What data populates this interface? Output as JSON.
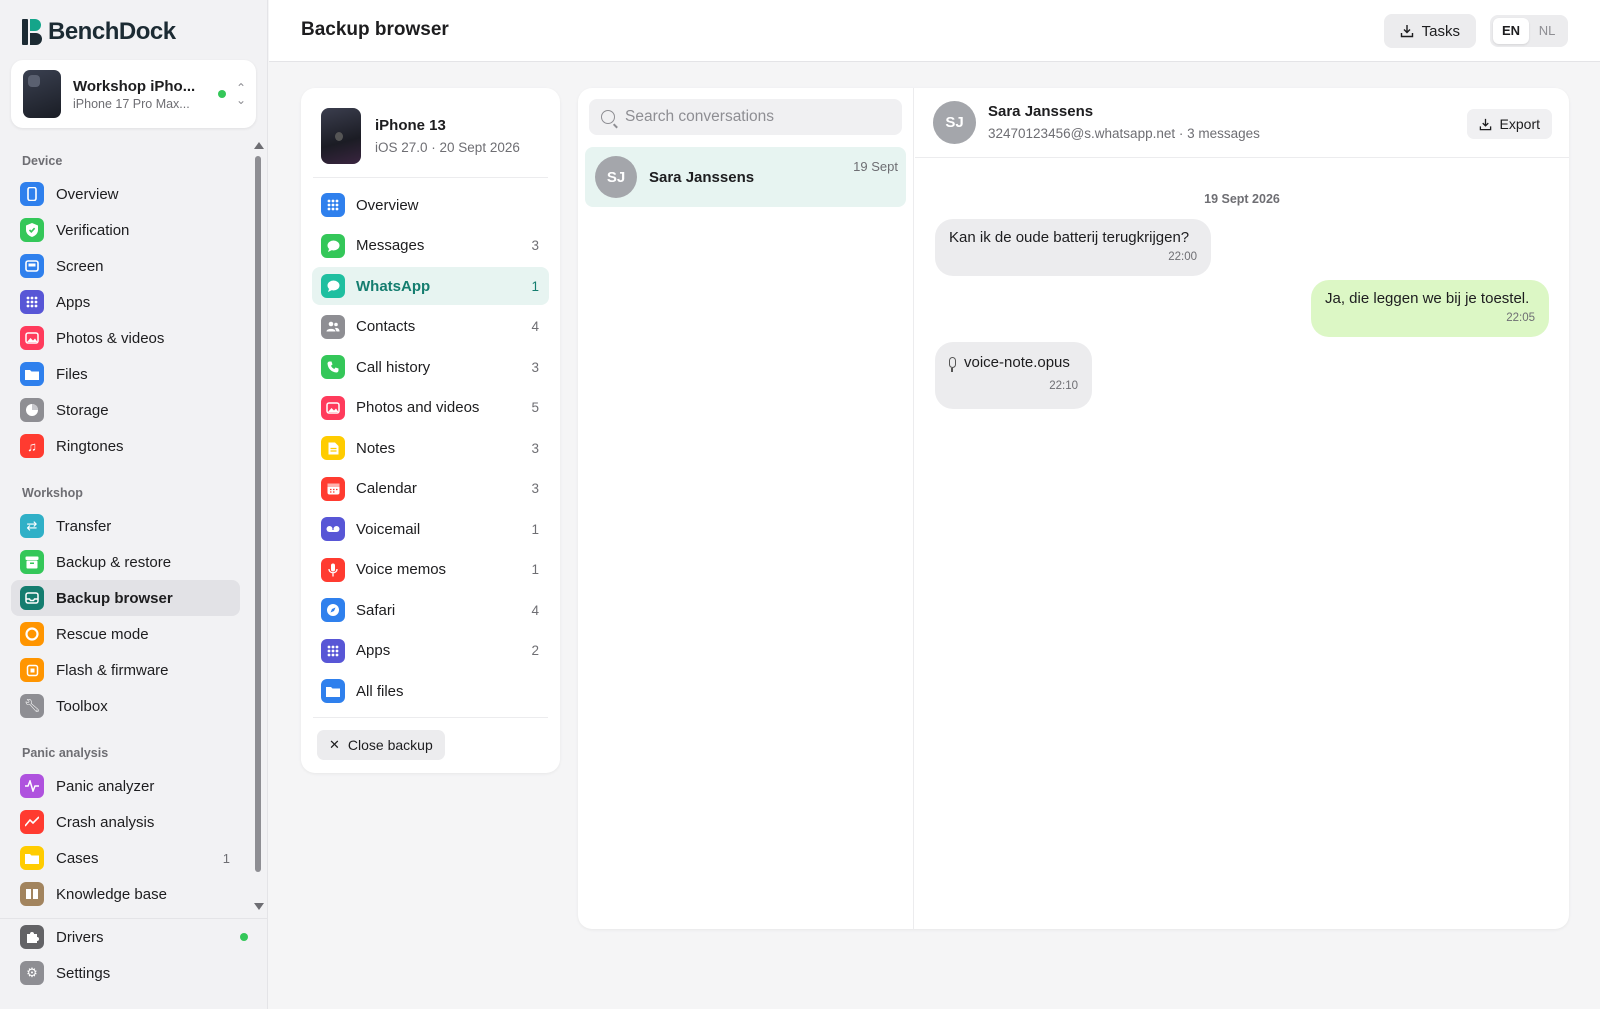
{
  "app": {
    "name_part1": "Bench",
    "name_part2": "Dock"
  },
  "device": {
    "name": "Workshop iPho...",
    "model": "iPhone 17 Pro Max..."
  },
  "sidebar": {
    "sections": [
      {
        "title": "Device",
        "items": [
          {
            "label": "Overview",
            "icon": "phone-icon",
            "color": "#2f80ed"
          },
          {
            "label": "Verification",
            "icon": "shield-check-icon",
            "color": "#34c759"
          },
          {
            "label": "Screen",
            "icon": "screen-icon",
            "color": "#2f80ed"
          },
          {
            "label": "Apps",
            "icon": "grid-icon",
            "color": "#5856d6"
          },
          {
            "label": "Photos & videos",
            "icon": "photo-icon",
            "color": "#ff3b5c"
          },
          {
            "label": "Files",
            "icon": "folder-icon",
            "color": "#2f80ed"
          },
          {
            "label": "Storage",
            "icon": "pie-chart-icon",
            "color": "#8e8e93"
          },
          {
            "label": "Ringtones",
            "icon": "music-icon",
            "color": "#ff3b30"
          }
        ]
      },
      {
        "title": "Workshop",
        "items": [
          {
            "label": "Transfer",
            "icon": "transfer-icon",
            "color": "#30b0c7"
          },
          {
            "label": "Backup & restore",
            "icon": "archive-icon",
            "color": "#34c759"
          },
          {
            "label": "Backup browser",
            "icon": "inbox-icon",
            "color": "#147d6f"
          },
          {
            "label": "Rescue mode",
            "icon": "lifebuoy-icon",
            "color": "#ff9500"
          },
          {
            "label": "Flash & firmware",
            "icon": "chip-icon",
            "color": "#ff9500"
          },
          {
            "label": "Toolbox",
            "icon": "wrench-icon",
            "color": "#8e8e93"
          }
        ]
      },
      {
        "title": "Panic analysis",
        "items": [
          {
            "label": "Panic analyzer",
            "icon": "pulse-icon",
            "color": "#af52de"
          },
          {
            "label": "Crash analysis",
            "icon": "trend-icon",
            "color": "#ff3b30"
          },
          {
            "label": "Cases",
            "icon": "folder-icon",
            "color": "#ffcc00",
            "badge": "1"
          },
          {
            "label": "Knowledge base",
            "icon": "book-icon",
            "color": "#a2845e"
          }
        ]
      }
    ],
    "footer": [
      {
        "label": "Drivers",
        "icon": "puzzle-icon",
        "color": "#636366"
      },
      {
        "label": "Settings",
        "icon": "gear-icon",
        "color": "#8e8e93"
      }
    ]
  },
  "header": {
    "title": "Backup browser",
    "tasks_label": "Tasks",
    "lang_en": "EN",
    "lang_nl": "NL"
  },
  "backup": {
    "device_name": "iPhone 13",
    "device_sub": "iOS 27.0 · 20 Sept 2026",
    "categories": [
      {
        "label": "Overview",
        "count": "",
        "icon": "grid-icon",
        "color": "#2f80ed"
      },
      {
        "label": "Messages",
        "count": "3",
        "icon": "message-icon",
        "color": "#34c759"
      },
      {
        "label": "WhatsApp",
        "count": "1",
        "icon": "whatsapp-icon",
        "color": "#1fbfa0"
      },
      {
        "label": "Contacts",
        "count": "4",
        "icon": "contacts-icon",
        "color": "#8e8e93"
      },
      {
        "label": "Call history",
        "count": "3",
        "icon": "phone-call-icon",
        "color": "#34c759"
      },
      {
        "label": "Photos and videos",
        "count": "5",
        "icon": "photo-icon",
        "color": "#ff3b5c"
      },
      {
        "label": "Notes",
        "count": "3",
        "icon": "note-icon",
        "color": "#ffcc00"
      },
      {
        "label": "Calendar",
        "count": "3",
        "icon": "calendar-icon",
        "color": "#ff3b30"
      },
      {
        "label": "Voicemail",
        "count": "1",
        "icon": "voicemail-icon",
        "color": "#5856d6"
      },
      {
        "label": "Voice memos",
        "count": "1",
        "icon": "mic-icon",
        "color": "#ff3b30"
      },
      {
        "label": "Safari",
        "count": "4",
        "icon": "compass-icon",
        "color": "#2f80ed"
      },
      {
        "label": "Apps",
        "count": "2",
        "icon": "grid-icon",
        "color": "#5856d6"
      },
      {
        "label": "All files",
        "count": "",
        "icon": "folder-icon",
        "color": "#2f80ed"
      }
    ],
    "close_label": "Close backup"
  },
  "conversations": {
    "search_placeholder": "Search conversations",
    "items": [
      {
        "initials": "SJ",
        "name": "Sara Janssens",
        "date": "19 Sept"
      }
    ]
  },
  "thread": {
    "initials": "SJ",
    "name": "Sara Janssens",
    "subtitle": "32470123456@s.whatsapp.net · 3 messages",
    "export_label": "Export",
    "day": "19 Sept 2026",
    "messages": [
      {
        "text": "Kan ik de oude batterij terugkrijgen?",
        "time": "22:00"
      },
      {
        "text": "Ja, die leggen we bij je toestel.",
        "time": "22:05"
      },
      {
        "text": "voice-note.opus",
        "time": "22:10"
      }
    ]
  }
}
